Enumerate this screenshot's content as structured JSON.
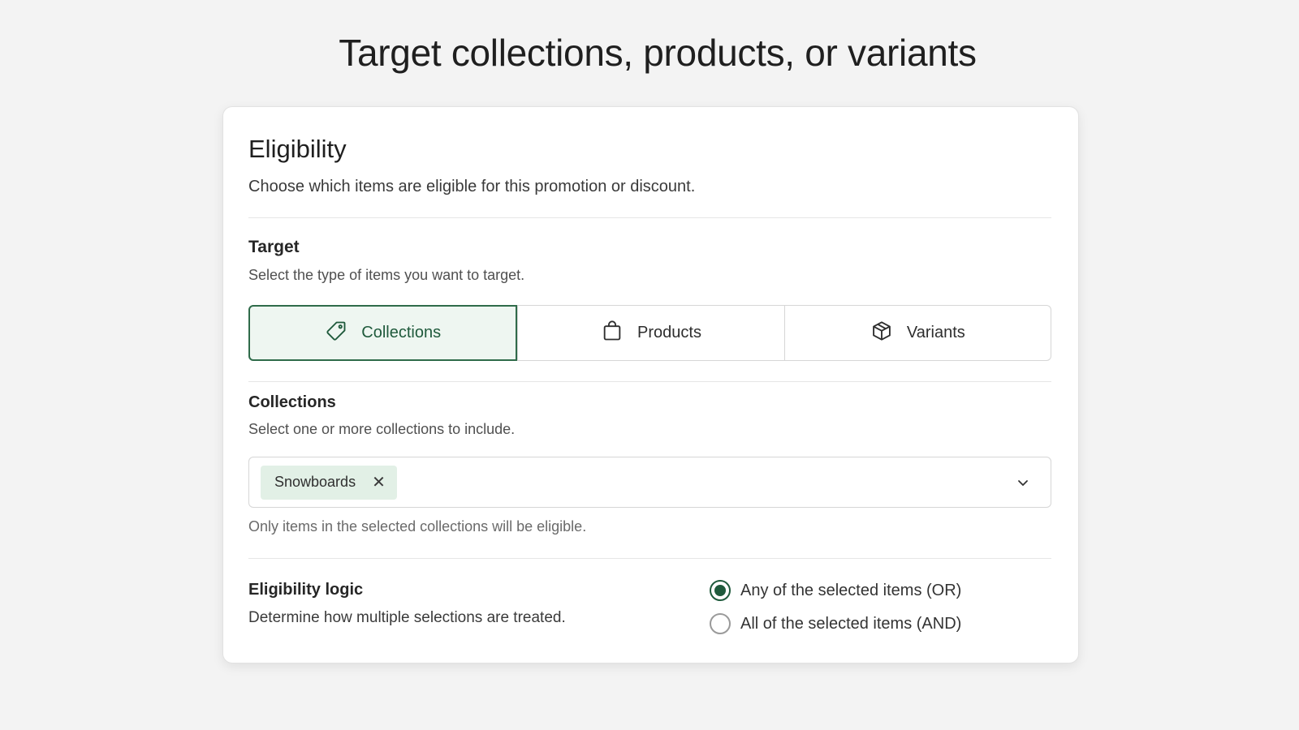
{
  "page": {
    "title": "Target collections, products, or variants"
  },
  "card": {
    "heading": "Eligibility",
    "description": "Choose which items are eligible for this promotion or discount."
  },
  "target": {
    "label": "Target",
    "description": "Select the type of items you want to target.",
    "options": [
      {
        "label": "Collections",
        "icon": "tag-icon",
        "selected": true
      },
      {
        "label": "Products",
        "icon": "shopping-bag-icon",
        "selected": false
      },
      {
        "label": "Variants",
        "icon": "box-icon",
        "selected": false
      }
    ]
  },
  "collections": {
    "label": "Collections",
    "description": "Select one or more collections to include.",
    "selected_chips": [
      "Snowboards"
    ],
    "chip_remove_glyph": "✕",
    "helper": "Only items in the selected collections will be eligible."
  },
  "logic": {
    "label": "Eligibility logic",
    "description": "Determine how multiple selections are treated.",
    "options": [
      {
        "label": "Any of the selected items (OR)",
        "checked": true
      },
      {
        "label": "All of the selected items (AND)",
        "checked": false
      }
    ]
  },
  "colors": {
    "accent": "#1f5a3c",
    "accent_bg": "#eef6f1",
    "chip_bg": "#e2f0e6",
    "background": "#f3f3f3"
  }
}
